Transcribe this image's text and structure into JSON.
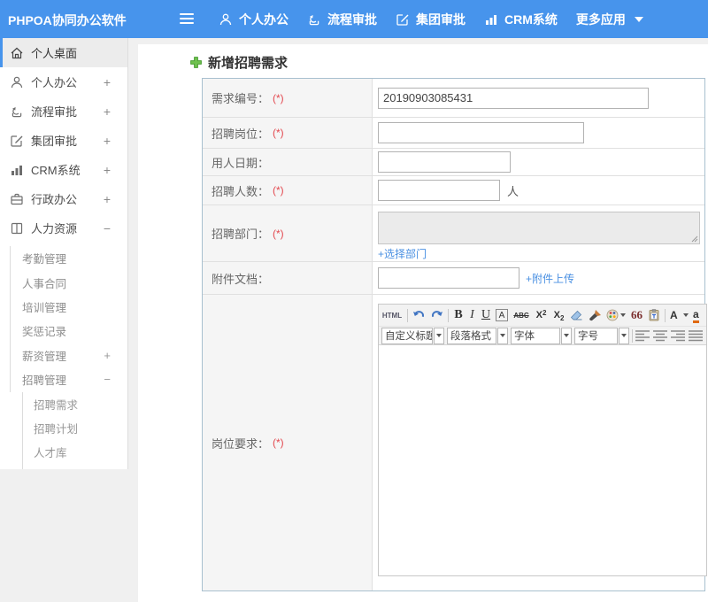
{
  "header": {
    "logo": "PHPOA协同办公软件",
    "nav": [
      {
        "label": "个人办公",
        "icon": "user-icon"
      },
      {
        "label": "流程审批",
        "icon": "flow-icon"
      },
      {
        "label": "集团审批",
        "icon": "edit-icon"
      },
      {
        "label": "CRM系统",
        "icon": "chart-icon"
      },
      {
        "label": "更多应用",
        "icon": "caret-down-icon"
      }
    ]
  },
  "sidebar": {
    "items": [
      {
        "label": "个人桌面",
        "icon": "home-icon",
        "active": true
      },
      {
        "label": "个人办公",
        "icon": "user-icon",
        "expander": "+"
      },
      {
        "label": "流程审批",
        "icon": "flow-icon",
        "expander": "+"
      },
      {
        "label": "集团审批",
        "icon": "edit-icon",
        "expander": "+"
      },
      {
        "label": "CRM系统",
        "icon": "chart-icon",
        "expander": "+"
      },
      {
        "label": "行政办公",
        "icon": "briefcase-icon",
        "expander": "+"
      },
      {
        "label": "人力资源",
        "icon": "book-icon",
        "expander": "−"
      }
    ],
    "hr_sub": [
      {
        "label": "考勤管理"
      },
      {
        "label": "人事合同"
      },
      {
        "label": "培训管理"
      },
      {
        "label": "奖惩记录"
      },
      {
        "label": "薪资管理",
        "expander": "+"
      },
      {
        "label": "招聘管理",
        "expander": "−"
      }
    ],
    "recruit_sub": [
      {
        "label": "招聘需求"
      },
      {
        "label": "招聘计划"
      },
      {
        "label": "人才库"
      }
    ]
  },
  "main": {
    "title": "新增招聘需求",
    "form": {
      "req_no": {
        "label": "需求编号：",
        "required": "(*)",
        "value": "20190903085431"
      },
      "position": {
        "label": "招聘岗位：",
        "required": "(*)"
      },
      "date": {
        "label": "用人日期："
      },
      "count": {
        "label": "招聘人数：",
        "required": "(*)",
        "suffix": "人"
      },
      "dept": {
        "label": "招聘部门：",
        "required": "(*)",
        "link": "+选择部门"
      },
      "attach": {
        "label": "附件文档：",
        "link": "+附件上传"
      },
      "require": {
        "label": "岗位要求：",
        "required": "(*)"
      }
    },
    "editor": {
      "html_btn": "HTML",
      "bold": "B",
      "italic": "I",
      "underline": "U",
      "font_box": "A",
      "strike": "ABC",
      "sup_base": "X",
      "sup": "2",
      "sub": "2",
      "quote": "66",
      "font_color": "A",
      "highlight": "a",
      "dropdowns": [
        {
          "label": "自定义标题"
        },
        {
          "label": "段落格式"
        },
        {
          "label": "字体"
        },
        {
          "label": "字号"
        }
      ]
    },
    "colors": {
      "accent": "#4794ec",
      "link": "#4a90e2",
      "required": "#e3484f"
    }
  }
}
